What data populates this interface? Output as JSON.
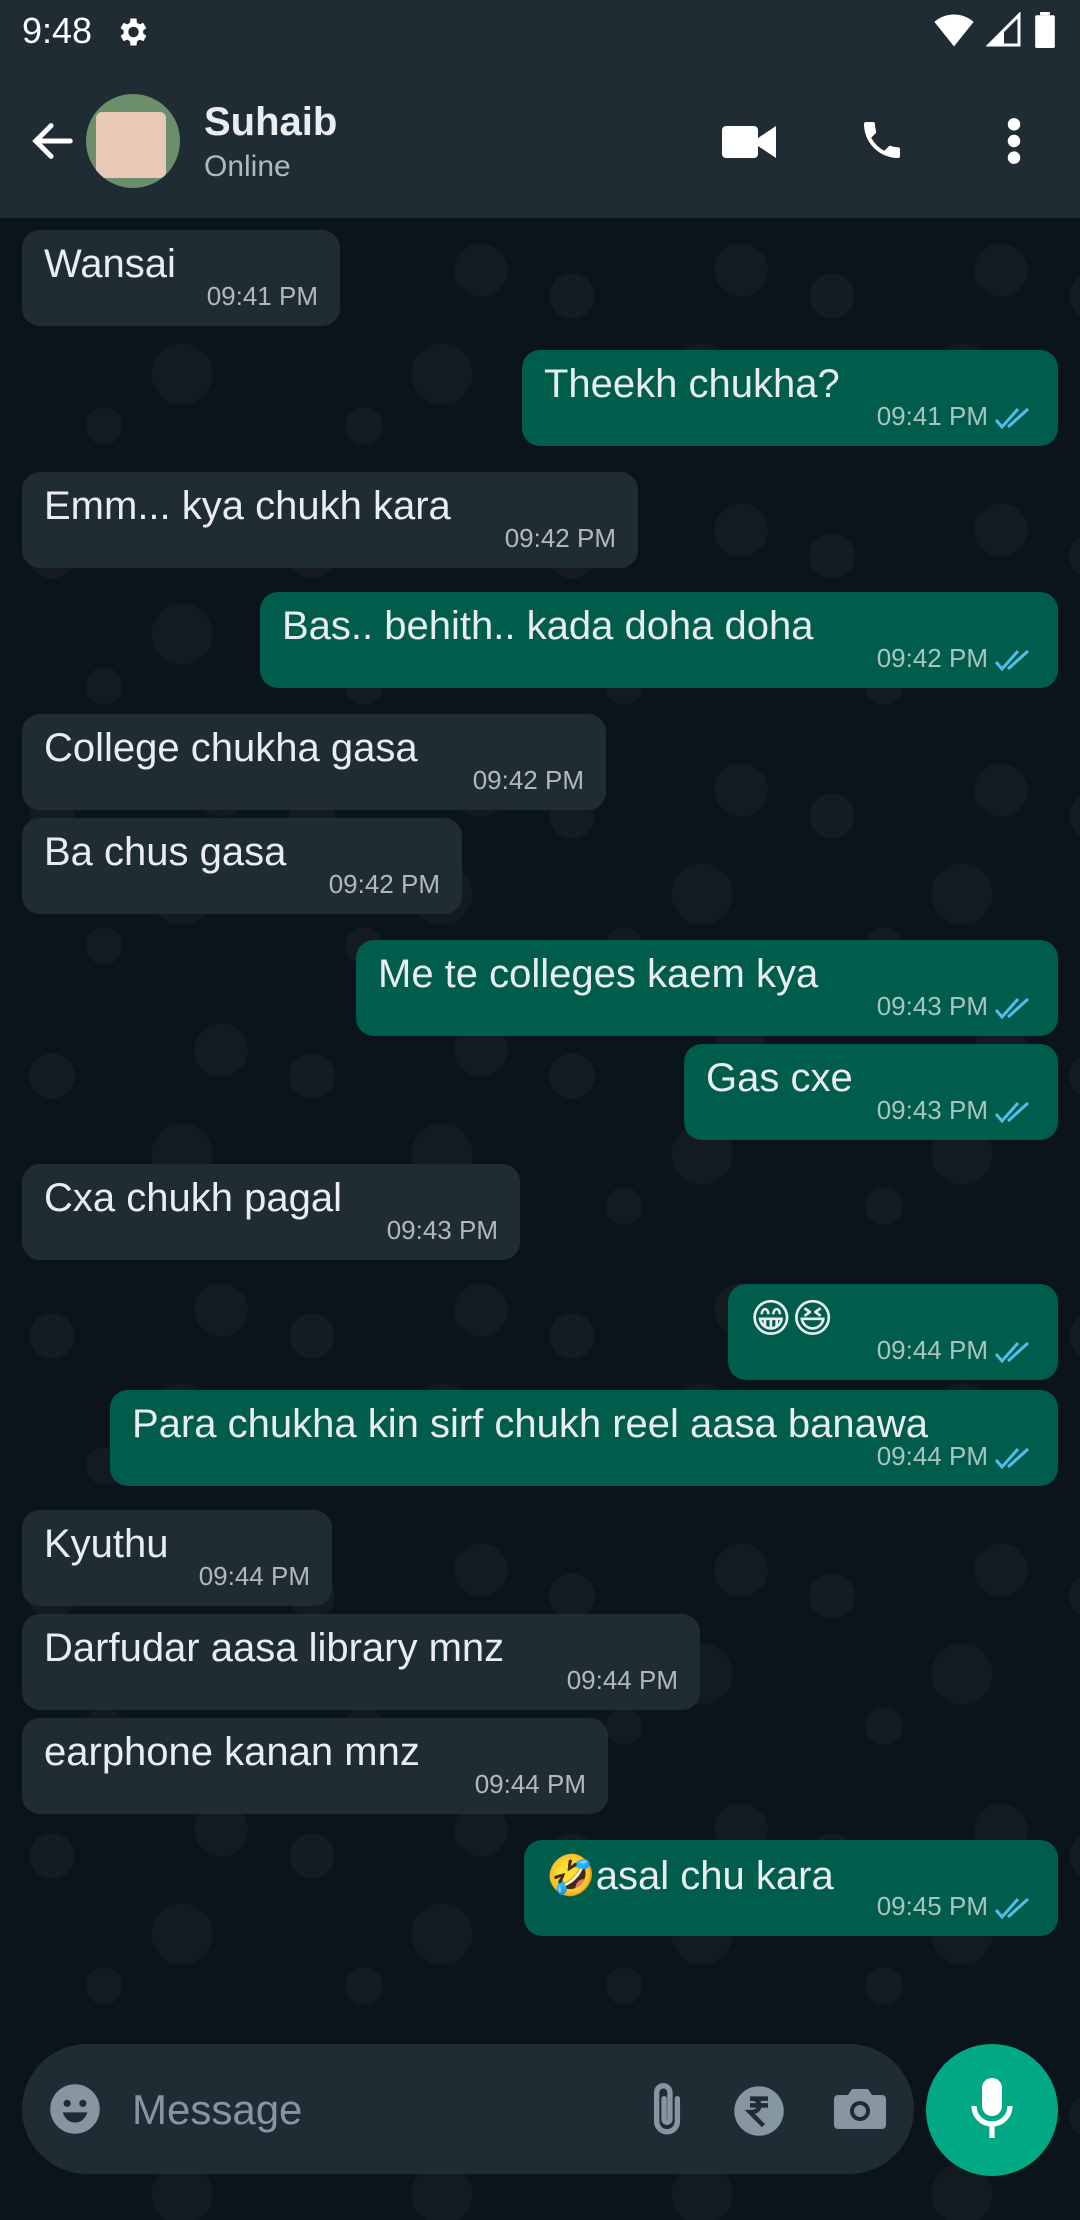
{
  "status_bar": {
    "time": "9:48"
  },
  "header": {
    "contact_name": "Suhaib",
    "contact_status": "Online"
  },
  "messages": [
    {
      "dir": "in",
      "text": "Wansai",
      "time": "09:41 PM"
    },
    {
      "dir": "out",
      "text": "Theekh chukha?",
      "time": "09:41 PM"
    },
    {
      "dir": "in",
      "text": "Emm... kya chukh kara",
      "time": "09:42 PM"
    },
    {
      "dir": "out",
      "text": "Bas.. behith.. kada doha doha",
      "time": "09:42 PM"
    },
    {
      "dir": "in",
      "text": "College chukha gasa",
      "time": "09:42 PM"
    },
    {
      "dir": "in",
      "text": "Ba chus gasa",
      "time": "09:42 PM"
    },
    {
      "dir": "out",
      "text": "Me te colleges kaem kya",
      "time": "09:43 PM"
    },
    {
      "dir": "out",
      "text": "Gas cxe",
      "time": "09:43 PM"
    },
    {
      "dir": "in",
      "text": "Cxa chukh pagal",
      "time": "09:43 PM"
    },
    {
      "dir": "out",
      "text": "😁😆",
      "time": "09:44 PM"
    },
    {
      "dir": "out",
      "text": "Para chukha kin sirf chukh reel aasa banawa",
      "time": "09:44 PM"
    },
    {
      "dir": "in",
      "text": "Kyuthu",
      "time": "09:44 PM"
    },
    {
      "dir": "in",
      "text": "Darfudar aasa library mnz",
      "time": "09:44 PM"
    },
    {
      "dir": "in",
      "text": "earphone kanan mnz",
      "time": "09:44 PM"
    },
    {
      "dir": "out",
      "text": "🤣asal chu kara",
      "time": "09:45 PM"
    }
  ],
  "composer": {
    "placeholder": "Message"
  },
  "colors": {
    "incoming": "#202c33",
    "outgoing": "#005c4b",
    "accent": "#00a884",
    "ticks": "#53bdeb"
  }
}
